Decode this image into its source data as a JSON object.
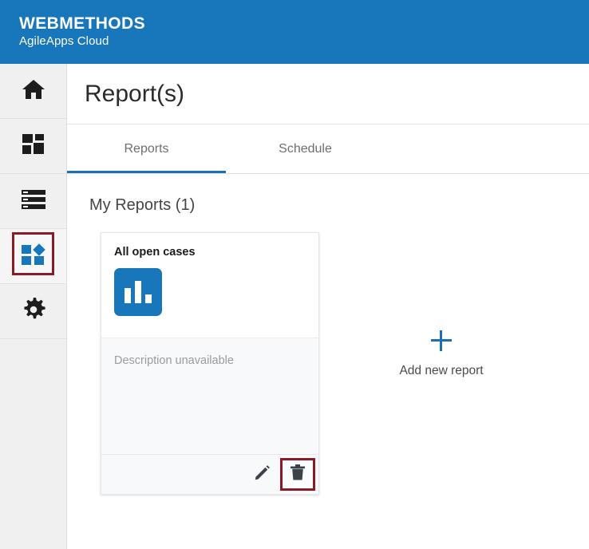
{
  "header": {
    "brand_main": "WEBMETHODS",
    "brand_sub": "AgileApps Cloud",
    "background_color": "#1877ba"
  },
  "sidebar": {
    "items": [
      {
        "name": "home",
        "icon": "home-icon",
        "selected": false
      },
      {
        "name": "dashboard",
        "icon": "dashboard-grid-icon",
        "selected": false
      },
      {
        "name": "records",
        "icon": "list-rows-icon",
        "selected": false
      },
      {
        "name": "apps",
        "icon": "apps-tiles-icon",
        "selected": true
      },
      {
        "name": "settings",
        "icon": "gear-icon",
        "selected": false
      }
    ],
    "highlight_color": "#8b1a26",
    "selected_icon_color": "#1877ba"
  },
  "page": {
    "title": "Report(s)"
  },
  "tabs": {
    "items": [
      {
        "label": "Reports",
        "active": true
      },
      {
        "label": "Schedule",
        "active": false
      }
    ],
    "active_underline_color": "#1b6fb5"
  },
  "main": {
    "section_heading": "My Reports (1)",
    "cards": [
      {
        "title": "All open cases",
        "icon": "bar-chart-icon",
        "icon_color": "#1877ba",
        "description": "Description unavailable",
        "actions": [
          {
            "name": "edit",
            "icon": "pencil-icon",
            "highlighted": false
          },
          {
            "name": "delete",
            "icon": "trash-icon",
            "highlighted": true
          }
        ]
      }
    ],
    "add_new": {
      "icon": "plus-icon",
      "label": "Add new report",
      "color": "#1b6fb5"
    }
  }
}
